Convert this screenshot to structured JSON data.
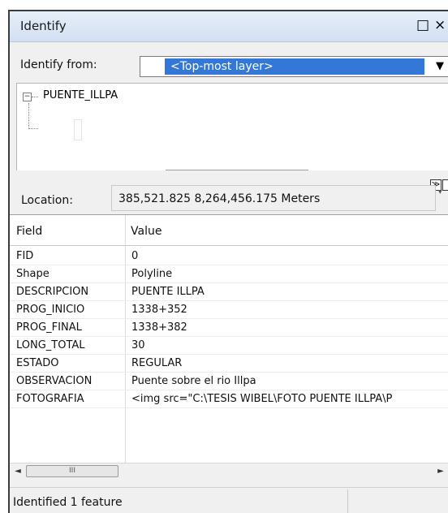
{
  "window": {
    "title": "Identify",
    "restore_glyph": "□",
    "close_glyph": "×"
  },
  "identify_from": {
    "label": "Identify from:",
    "selected": "<Top-most layer>",
    "arrow": "▼"
  },
  "tree": {
    "expander": "−",
    "root_label": "PUENTE_ILLPA"
  },
  "expand_button": "≫",
  "location": {
    "label": "Location:",
    "value": "385,521.825  8,264,456.175 Meters"
  },
  "grid": {
    "headers": {
      "field": "Field",
      "value": "Value"
    },
    "rows": [
      {
        "field": "FID",
        "value": "0"
      },
      {
        "field": "Shape",
        "value": "Polyline"
      },
      {
        "field": "DESCRIPCION",
        "value": "PUENTE ILLPA"
      },
      {
        "field": "PROG_INICIO",
        "value": "1338+352"
      },
      {
        "field": "PROG_FINAL",
        "value": "1338+382"
      },
      {
        "field": "LONG_TOTAL",
        "value": "30"
      },
      {
        "field": "ESTADO",
        "value": "REGULAR"
      },
      {
        "field": "OBSERVACION",
        "value": "Puente sobre el rio Illpa"
      },
      {
        "field": "FOTOGRAFIA",
        "value": "<img src=\"C:\\TESIS WIBEL\\FOTO PUENTE ILLPA\\P"
      }
    ]
  },
  "hscroll": {
    "left_arrow": "◄",
    "thumb_grip": "III",
    "right_arrow": "►"
  },
  "status": {
    "text": "Identified 1 feature"
  },
  "colors": {
    "selection": "#3378d6",
    "titlebar": "#dce7f5"
  }
}
